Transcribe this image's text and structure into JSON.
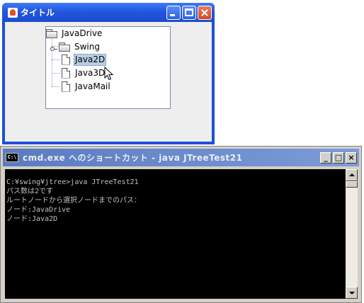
{
  "swing_window": {
    "title": "タイトル",
    "tree": {
      "root": "JavaDrive",
      "folder": "Swing",
      "leaves": [
        "Java2D",
        "Java3D",
        "JavaMail"
      ],
      "selected": "Java2D"
    }
  },
  "cmd_window": {
    "title": "cmd.exe へのショートカット - java JTreeTest21",
    "icon_text": "C:\\",
    "min_glyph": "_",
    "max_glyph": "□",
    "close_glyph": "×",
    "lines": [
      "C:¥swing¥jtree>java JTreeTest21",
      "パス数は2です",
      "ルートノードから選択ノードまでのパス：",
      "ノード:JavaDrive",
      "ノード:Java2D"
    ]
  },
  "colors": {
    "xp_title": "#2356dc",
    "selection": "#b8cfe5",
    "console_bg": "#000000",
    "console_text": "#c0c0c0"
  }
}
